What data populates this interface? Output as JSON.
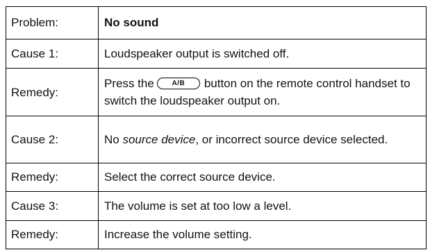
{
  "table": {
    "header": {
      "label": "Problem:",
      "value": "No sound"
    },
    "cause1": {
      "label": "Cause 1:",
      "text": "Loudspeaker output is switched off."
    },
    "remedy1": {
      "label": "Remedy:",
      "text_before": "Press the",
      "button": "A/B",
      "text_after": "button on the remote control handset to switch the loudspeaker output on."
    },
    "cause2": {
      "label": "Cause 2:",
      "text_before": "No ",
      "italic_term": "source device",
      "text_after": ", or incorrect source device selected."
    },
    "remedy2": {
      "label": "Remedy:",
      "text": "Select the correct source device."
    },
    "cause3": {
      "label": "Cause 3:",
      "text": "The volume is set at too low a level."
    },
    "remedy3": {
      "label": "Remedy:",
      "text": "Increase the volume setting."
    }
  }
}
